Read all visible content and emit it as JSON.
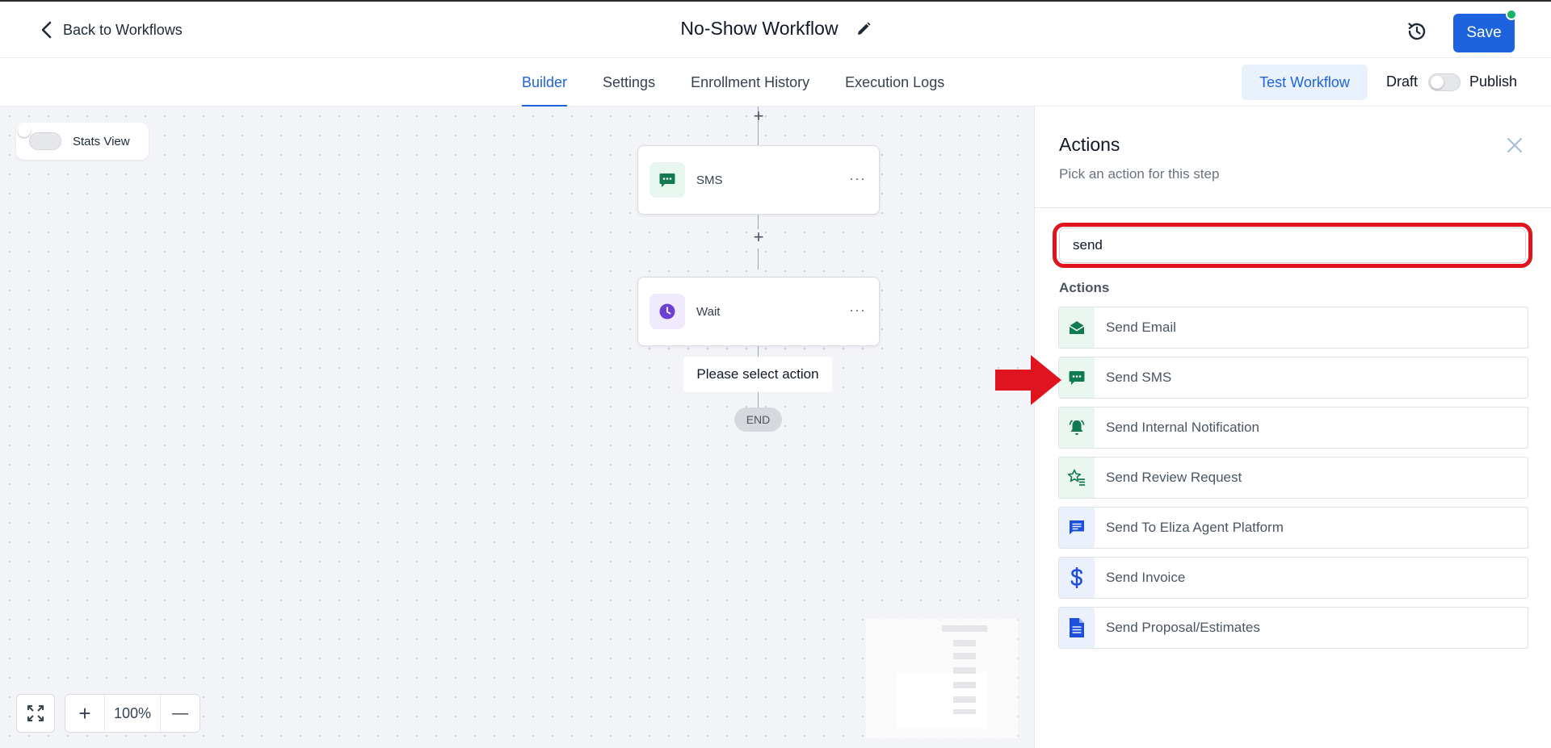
{
  "header": {
    "back_label": "Back to Workflows",
    "workflow_title": "No-Show Workflow",
    "save_label": "Save"
  },
  "subnav": {
    "tabs": [
      {
        "label": "Builder",
        "active": true
      },
      {
        "label": "Settings",
        "active": false
      },
      {
        "label": "Enrollment History",
        "active": false
      },
      {
        "label": "Execution Logs",
        "active": false
      }
    ],
    "test_label": "Test Workflow",
    "draft_label": "Draft",
    "publish_label": "Publish"
  },
  "canvas": {
    "stats_label": "Stats View",
    "nodes": [
      {
        "label": "SMS",
        "icon": "sms-icon"
      },
      {
        "label": "Wait",
        "icon": "clock-icon"
      }
    ],
    "more_label": "···",
    "plus_label": "+",
    "placeholder_label": "Please select action",
    "end_label": "END",
    "zoom": {
      "in_label": "+",
      "value": "100%",
      "out_label": "—"
    }
  },
  "panel": {
    "title": "Actions",
    "subtitle": "Pick an action for this step",
    "search_value": "send",
    "section_label": "Actions",
    "actions": [
      {
        "label": "Send Email",
        "icon": "envelope-open-icon"
      },
      {
        "label": "Send SMS",
        "icon": "sms-icon"
      },
      {
        "label": "Send Internal Notification",
        "icon": "bell-icon"
      },
      {
        "label": "Send Review Request",
        "icon": "star-list-icon"
      },
      {
        "label": "Send To Eliza Agent Platform",
        "icon": "chat-icon"
      },
      {
        "label": "Send Invoice",
        "icon": "dollar-icon"
      },
      {
        "label": "Send Proposal/Estimates",
        "icon": "document-icon"
      }
    ]
  },
  "colors": {
    "accent": "#1d63e0",
    "green": "#127a52",
    "highlight_red": "#e0141e"
  }
}
